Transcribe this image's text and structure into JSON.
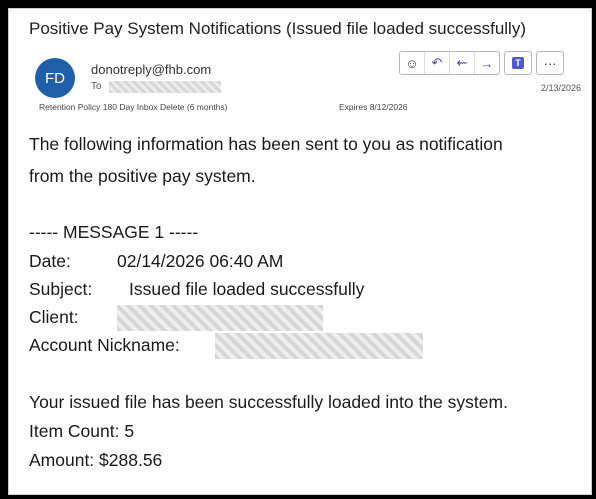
{
  "email": {
    "subject": "Positive Pay System Notifications (Issued file loaded successfully)",
    "sender_initials": "FD",
    "sender_email": "donotreply@fhb.com",
    "to_label": "To",
    "received_date": "2/13/2026",
    "retention_policy": "Retention Policy 180 Day Inbox Delete (6 months)",
    "expires": "Expires 8/12/2026"
  },
  "actions": {
    "emoji_icon": "☺",
    "reply_icon": "↶",
    "reply_all_icon": "⇜",
    "forward_icon": "→",
    "teams_icon": "T",
    "more_icon": "···"
  },
  "body": {
    "intro_line1": "The following information has been sent to you as notification",
    "intro_line2": "from the positive pay system.",
    "message_header": "----- MESSAGE 1 -----",
    "date_label": "Date:",
    "date_value": "02/14/2026 06:40 AM",
    "subject_label": "Subject:",
    "subject_value": "Issued file loaded successfully",
    "client_label": "Client:",
    "account_label": "Account Nickname:",
    "result_line": "Your issued file has been successfully loaded into the system.",
    "item_count": "Item Count: 5",
    "amount": "Amount: $288.56"
  }
}
